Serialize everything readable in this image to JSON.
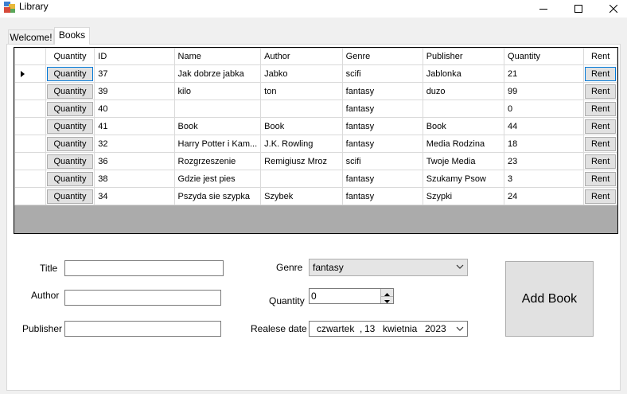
{
  "window": {
    "title": "Library"
  },
  "tabs": [
    {
      "label": "Welcome!"
    },
    {
      "label": "Books"
    }
  ],
  "grid": {
    "columns": [
      "Quantity",
      "ID",
      "Name",
      "Author",
      "Genre",
      "Publisher",
      "Quantity",
      "Rent"
    ],
    "button_labels": {
      "quantity": "Quantity",
      "rent": "Rent"
    },
    "rows": [
      {
        "id": "37",
        "name": "Jak dobrze jabka",
        "author": "Jabko",
        "genre": "scifi",
        "publisher": "Jablonka",
        "quantity": "21"
      },
      {
        "id": "39",
        "name": "kilo",
        "author": "ton",
        "genre": "fantasy",
        "publisher": "duzo",
        "quantity": "99"
      },
      {
        "id": "40",
        "name": "",
        "author": "",
        "genre": "fantasy",
        "publisher": "",
        "quantity": "0"
      },
      {
        "id": "41",
        "name": "Book",
        "author": "Book",
        "genre": "fantasy",
        "publisher": "Book",
        "quantity": "44"
      },
      {
        "id": "32",
        "name": "Harry Potter i Kam...",
        "author": "J.K. Rowling",
        "genre": "fantasy",
        "publisher": "Media Rodzina",
        "quantity": "18"
      },
      {
        "id": "36",
        "name": "Rozgrzeszenie",
        "author": "Remigiusz Mroz",
        "genre": "scifi",
        "publisher": "Twoje Media",
        "quantity": "23"
      },
      {
        "id": "38",
        "name": "Gdzie jest pies",
        "author": "",
        "genre": "fantasy",
        "publisher": "Szukamy Psow",
        "quantity": "3"
      },
      {
        "id": "34",
        "name": "Pszyda sie szypka",
        "author": "Szybek",
        "genre": "fantasy",
        "publisher": "Szypki",
        "quantity": "24"
      }
    ]
  },
  "form": {
    "title_label": "Title",
    "author_label": "Author",
    "publisher_label": "Publisher",
    "genre_label": "Genre",
    "quantity_label": "Quantity",
    "release_label": "Realese date",
    "title_value": "",
    "author_value": "",
    "publisher_value": "",
    "genre_value": "fantasy",
    "quantity_value": "0",
    "date": {
      "weekday": "czwartek",
      "day": "13",
      "month": "kwietnia",
      "year": "2023"
    },
    "add_button": "Add Book"
  }
}
